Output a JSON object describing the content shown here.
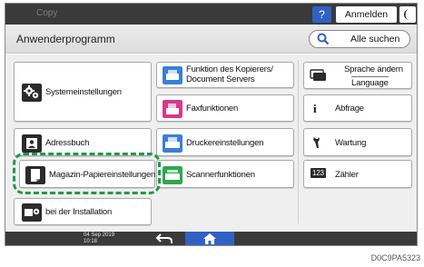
{
  "topbar": {
    "mode_label": "Copy",
    "help_label": "?",
    "login_label": "Anmelden",
    "colors": {
      "bar": "#3a3a3a",
      "accent": "#2f62c4"
    }
  },
  "header": {
    "title": "Anwenderprogramm",
    "search_label": "Alle suchen"
  },
  "main": {
    "left": {
      "system_settings": "Systemeinstellungen",
      "address_book": "Adressbuch",
      "tray_paper_settings": "Magazin-Papiereinstellungen",
      "installation": "bei der Installation"
    },
    "middle": {
      "copier_features_line1": "Funktion des Kopierers/",
      "copier_features_line2": "Document Servers",
      "fax_features": "Faxfunktionen",
      "printer_settings": "Druckereinstellungen",
      "scanner_features": "Scannerfunktionen"
    },
    "right": {
      "language_line1": "Sprache ändern",
      "language_line2": "Language",
      "inquiry": "Abfrage",
      "maintenance": "Wartung",
      "counter": "Zähler",
      "counter_icon_text": "123",
      "inquiry_icon_text": "i"
    }
  },
  "callout": {
    "color": "#1f9a48"
  },
  "bottombar": {
    "date": "04 Sep 2019",
    "time": "10:18"
  },
  "figure_code": "D0C9PA5323"
}
